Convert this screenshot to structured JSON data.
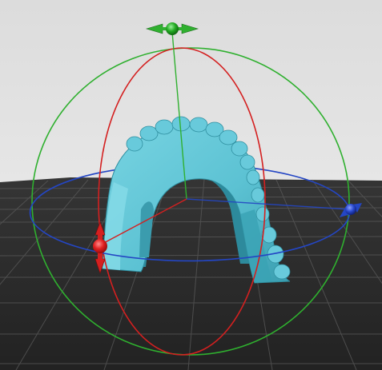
{
  "viewport": {
    "name": "3D viewport",
    "background_top": "#dcdcdc",
    "background_bottom": "#f2f2f2",
    "floor_color": "#2b2b2b",
    "grid_color": "#5a5a5a"
  },
  "model": {
    "name": "dental-arch-model",
    "color": "#5fc6d6",
    "shadow_color": "#2f8fa0"
  },
  "gizmo": {
    "x_axis_color": "#e02020",
    "y_axis_color": "#20a020",
    "z_axis_color": "#1f3fbf",
    "icons": [
      "move-y-arrows-icon",
      "rotate-handle-z-icon",
      "rotate-handle-x-icon"
    ]
  }
}
